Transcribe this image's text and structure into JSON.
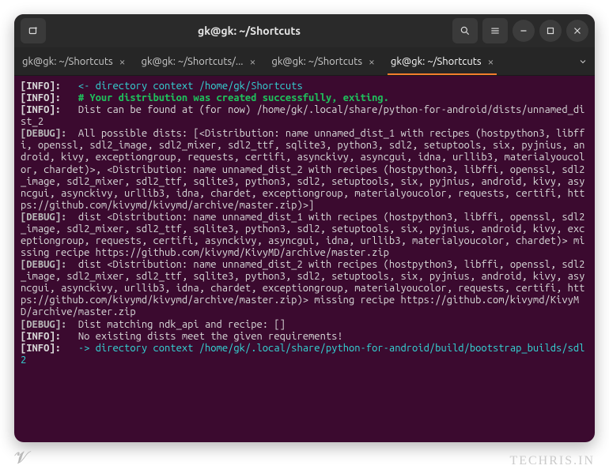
{
  "titlebar": {
    "title": "gk@gk: ~/Shortcuts"
  },
  "tabs": [
    {
      "label": "gk@gk: ~/Shortcuts",
      "active": false
    },
    {
      "label": "gk@gk: ~/Shortcuts/...",
      "active": false
    },
    {
      "label": "gk@gk: ~/Shortcuts",
      "active": false
    },
    {
      "label": "gk@gk: ~/Shortcuts",
      "active": true
    }
  ],
  "term": {
    "l1": {
      "tag": "[INFO]:",
      "body": "<- directory context /home/gk/Shortcuts"
    },
    "l2": {
      "tag": "[INFO]:",
      "body": "# Your distribution was created successfully, exiting."
    },
    "l3": {
      "tag": "[INFO]:",
      "body": "Dist can be found at (for now) /home/gk/.local/share/python-for-android/dists/unnamed_dist_2"
    },
    "l4": {
      "tag": "[DEBUG]:",
      "body": "All possible dists: [<Distribution: name unnamed_dist_1 with recipes (hostpython3, libffi, openssl, sdl2_image, sdl2_mixer, sdl2_ttf, sqlite3, python3, sdl2, setuptools, six, pyjnius, android, kivy, exceptiongroup, requests, certifi, asynckivy, asyncgui, idna, urllib3, materialyoucolor, chardet)>, <Distribution: name unnamed_dist_2 with recipes (hostpython3, libffi, openssl, sdl2_image, sdl2_mixer, sdl2_ttf, sqlite3, python3, sdl2, setuptools, six, pyjnius, android, kivy, asyncgui, asynckivy, urllib3, idna, chardet, exceptiongroup, materialyoucolor, requests, certifi, https://github.com/kivymd/kivymd/archive/master.zip)>]"
    },
    "l5": {
      "tag": "[DEBUG]:",
      "body": "dist <Distribution: name unnamed_dist_1 with recipes (hostpython3, libffi, openssl, sdl2_image, sdl2_mixer, sdl2_ttf, sqlite3, python3, sdl2, setuptools, six, pyjnius, android, kivy, exceptiongroup, requests, certifi, asynckivy, asyncgui, idna, urllib3, materialyoucolor, chardet)> missing recipe https://github.com/kivymd/KivyMD/archive/master.zip"
    },
    "l6": {
      "tag": "[DEBUG]:",
      "body": "dist <Distribution: name unnamed_dist_2 with recipes (hostpython3, libffi, openssl, sdl2_image, sdl2_mixer, sdl2_ttf, sqlite3, python3, sdl2, setuptools, six, pyjnius, android, kivy, asyncgui, asynckivy, urllib3, idna, chardet, exceptiongroup, materialyoucolor, requests, certifi, https://github.com/kivymd/kivymd/archive/master.zip)> missing recipe https://github.com/kivymd/KivyMD/archive/master.zip"
    },
    "l7": {
      "tag": "[DEBUG]:",
      "body": "Dist matching ndk_api and recipe: []"
    },
    "l8": {
      "tag": "[INFO]:",
      "body": "No existing dists meet the given requirements!"
    },
    "l9": {
      "tag": "[INFO]:",
      "body": "-> directory context /home/gk/.local/share/python-for-android/build/bootstrap_builds/sdl2"
    }
  },
  "watermark": "TECHRIS.IN",
  "caret_glyph": "𝓥"
}
